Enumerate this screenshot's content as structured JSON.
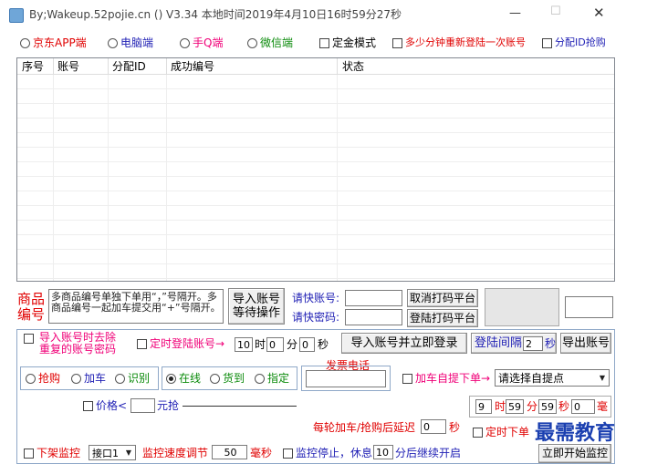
{
  "window": {
    "title": "By;Wakeup.52pojie.cn  ()    V3.34  本地时间2019年4月10日16时59分27秒",
    "min_glyph": "—",
    "max_glyph": "☐",
    "close_glyph": "✕"
  },
  "platforms": [
    {
      "label": "京东APP端",
      "selected": false
    },
    {
      "label": "电脑端",
      "selected": false
    },
    {
      "label": "手Q端",
      "selected": false
    },
    {
      "label": "微信端",
      "selected": false
    }
  ],
  "top_options": {
    "dingjin": "定金模式",
    "relogin": "多少分钟重新登陆一次账号",
    "fenpei": "分配ID抢购"
  },
  "table": {
    "columns": [
      "序号",
      "账号",
      "分配ID",
      "成功编号",
      "状态"
    ],
    "rows": []
  },
  "goods": {
    "label_line1": "商品",
    "label_line2": "编号",
    "placeholder_text": "多商品编号单独下单用“，”号隔开。多商品编号一起加车提交用“+”号隔开。",
    "import_btn": "导入账号等待操作"
  },
  "captcha": {
    "user_label": "请快账号:",
    "pass_label": "请快密码:",
    "cancel_btn": "取消打码平台",
    "login_btn": "登陆打码平台"
  },
  "row1": {
    "dedupe": "导入账号时去除重复的账号密码",
    "timed_login": "定时登陆账号→",
    "hour_value": "10",
    "hour_unit": "时",
    "min_value": "0",
    "min_unit": "分",
    "sec_value": "0",
    "sec_unit": "秒",
    "import_login_btn": "导入账号并立即登录",
    "interval_label": "登陆间隔",
    "interval_value": "2",
    "interval_unit": "秒",
    "export_btn": "导出账号"
  },
  "modes": [
    {
      "label": "抢购",
      "selected": false
    },
    {
      "label": "加车",
      "selected": false
    },
    {
      "label": "识别",
      "selected": false
    }
  ],
  "stock": [
    {
      "label": "在线",
      "selected": true
    },
    {
      "label": "货到",
      "selected": false
    },
    {
      "label": "指定",
      "selected": false
    }
  ],
  "phone": {
    "label": "发票电话",
    "value": ""
  },
  "addcart": {
    "label": "加车自提下单→",
    "select_value": "请选择自提点"
  },
  "price": {
    "label": "价格<",
    "value": "",
    "unit": "元抢"
  },
  "timer": {
    "hour": "9",
    "hour_unit": "时",
    "min": "59",
    "min_unit": "分",
    "sec": "59",
    "sec_unit": "秒",
    "ms": "0",
    "ms_unit": "毫"
  },
  "delay": {
    "label": "每轮加车/抢购后延迟",
    "value": "0",
    "unit": "秒"
  },
  "timed_order": {
    "label": "定时下单"
  },
  "bottom": {
    "offshelf": "下架监控",
    "port_value": "接口1",
    "speed_label": "监控速度调节",
    "speed_value": "50",
    "speed_unit": "毫秒",
    "stop_label": "监控停止，休息",
    "rest_value": "10",
    "rest_unit": "分后继续开启",
    "start_btn": "立即开始监控"
  },
  "watermark": "最需教育"
}
